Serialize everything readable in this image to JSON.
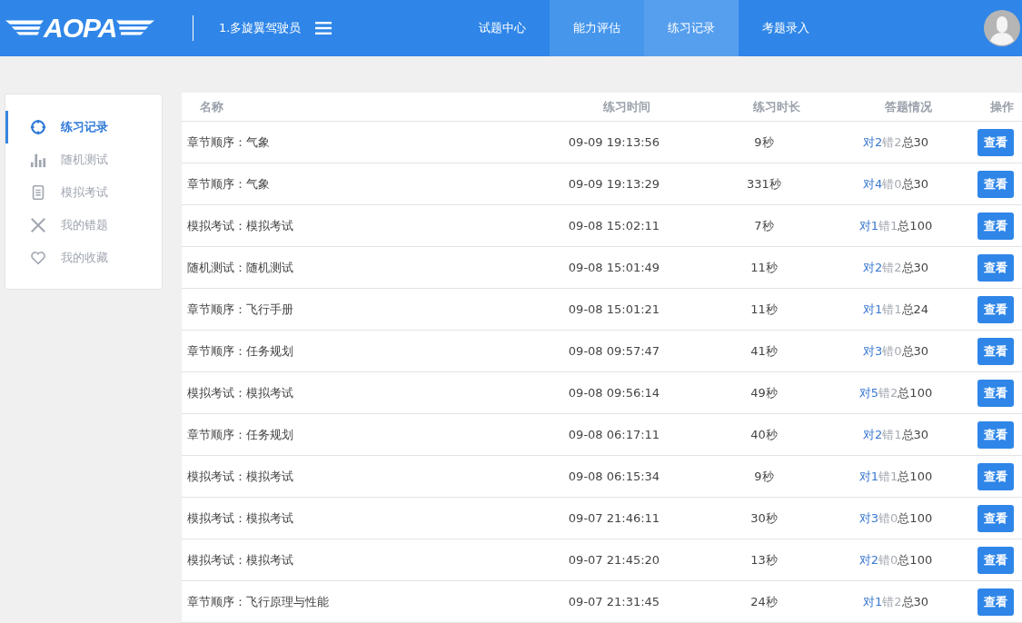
{
  "header": {
    "logo": "AOPA",
    "course": "1.多旋翼驾驶员",
    "nav": [
      {
        "label": "试题中心",
        "selected": false,
        "hovered": false
      },
      {
        "label": "能力评估",
        "selected": false,
        "hovered": true
      },
      {
        "label": "练习记录",
        "selected": true,
        "hovered": false
      },
      {
        "label": "考题录入",
        "selected": false,
        "hovered": false
      }
    ]
  },
  "sidebar": {
    "items": [
      {
        "label": "练习记录",
        "kind": "target",
        "selected": true
      },
      {
        "label": "随机测试",
        "kind": "bars",
        "selected": false
      },
      {
        "label": "模拟考试",
        "kind": "note",
        "selected": false
      },
      {
        "label": "我的错题",
        "kind": "cross",
        "selected": false
      },
      {
        "label": "我的收藏",
        "kind": "heart",
        "selected": false
      }
    ]
  },
  "table": {
    "columns": [
      "名称",
      "练习时间",
      "练习时长",
      "答题情况",
      "操作"
    ],
    "rows": [
      {
        "name": "章节顺序：气象",
        "time": "09-09 19:13:56",
        "duration": "9秒",
        "correct": "对2",
        "wrong": "错2",
        "total": "总30",
        "action": "查看"
      },
      {
        "name": "章节顺序：气象",
        "time": "09-09 19:13:29",
        "duration": "331秒",
        "correct": "对4",
        "wrong": "错0",
        "total": "总30",
        "action": "查看"
      },
      {
        "name": "模拟考试：模拟考试",
        "time": "09-08 15:02:11",
        "duration": "7秒",
        "correct": "对1",
        "wrong": "错1",
        "total": "总100",
        "action": "查看"
      },
      {
        "name": "随机测试：随机测试",
        "time": "09-08 15:01:49",
        "duration": "11秒",
        "correct": "对2",
        "wrong": "错2",
        "total": "总30",
        "action": "查看"
      },
      {
        "name": "章节顺序：飞行手册",
        "time": "09-08 15:01:21",
        "duration": "11秒",
        "correct": "对1",
        "wrong": "错1",
        "total": "总24",
        "action": "查看"
      },
      {
        "name": "章节顺序：任务规划",
        "time": "09-08 09:57:47",
        "duration": "41秒",
        "correct": "对3",
        "wrong": "错0",
        "total": "总30",
        "action": "查看"
      },
      {
        "name": "模拟考试：模拟考试",
        "time": "09-08 09:56:14",
        "duration": "49秒",
        "correct": "对5",
        "wrong": "错2",
        "total": "总100",
        "action": "查看"
      },
      {
        "name": "章节顺序：任务规划",
        "time": "09-08 06:17:11",
        "duration": "40秒",
        "correct": "对2",
        "wrong": "错1",
        "total": "总30",
        "action": "查看"
      },
      {
        "name": "模拟考试：模拟考试",
        "time": "09-08 06:15:34",
        "duration": "9秒",
        "correct": "对1",
        "wrong": "错1",
        "total": "总100",
        "action": "查看"
      },
      {
        "name": "模拟考试：模拟考试",
        "time": "09-07 21:46:11",
        "duration": "30秒",
        "correct": "对3",
        "wrong": "错0",
        "total": "总100",
        "action": "查看"
      },
      {
        "name": "模拟考试：模拟考试",
        "time": "09-07 21:45:20",
        "duration": "13秒",
        "correct": "对2",
        "wrong": "错0",
        "total": "总100",
        "action": "查看"
      },
      {
        "name": "章节顺序：飞行原理与性能",
        "time": "09-07 21:31:45",
        "duration": "24秒",
        "correct": "对1",
        "wrong": "错2",
        "total": "总30",
        "action": "查看"
      }
    ]
  }
}
